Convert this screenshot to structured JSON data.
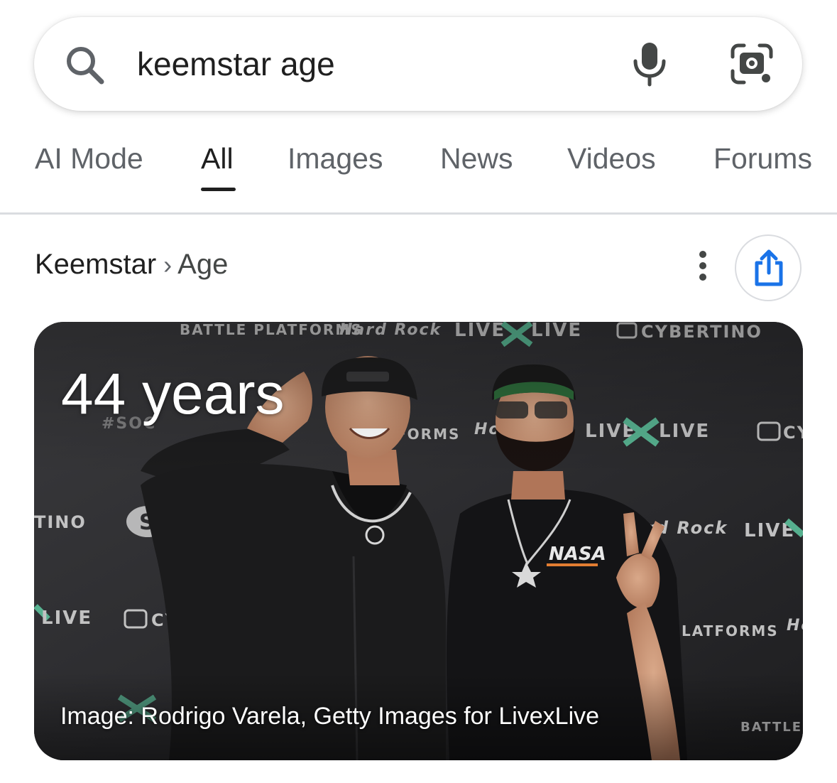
{
  "search": {
    "query": "keemstar age",
    "icons": {
      "search": "search-icon",
      "voice": "microphone-icon",
      "lens": "camera-lens-icon"
    }
  },
  "tabs": [
    {
      "label": "AI Mode",
      "active": false
    },
    {
      "label": "All",
      "active": true
    },
    {
      "label": "Images",
      "active": false
    },
    {
      "label": "News",
      "active": false
    },
    {
      "label": "Videos",
      "active": false
    },
    {
      "label": "Forums",
      "active": false
    }
  ],
  "breadcrumb": {
    "entity": "Keemstar",
    "separator": "›",
    "attribute": "Age"
  },
  "actions": {
    "more_icon": "more-vertical-icon",
    "share_icon": "share-icon",
    "share_color": "#1a73e8"
  },
  "answer_card": {
    "age": "44 years",
    "caption": "Image: Rodrigo Varela, Getty Images for LivexLive",
    "backdrop_logos": [
      "BATTLE PLATFORMS",
      "Hard Rock",
      "LIVE",
      "LIVE",
      "CYBERTINO",
      "#SOC",
      "STAT HERO",
      "TINO",
      "CYBERTIN",
      "LIVE",
      "NASA"
    ]
  }
}
